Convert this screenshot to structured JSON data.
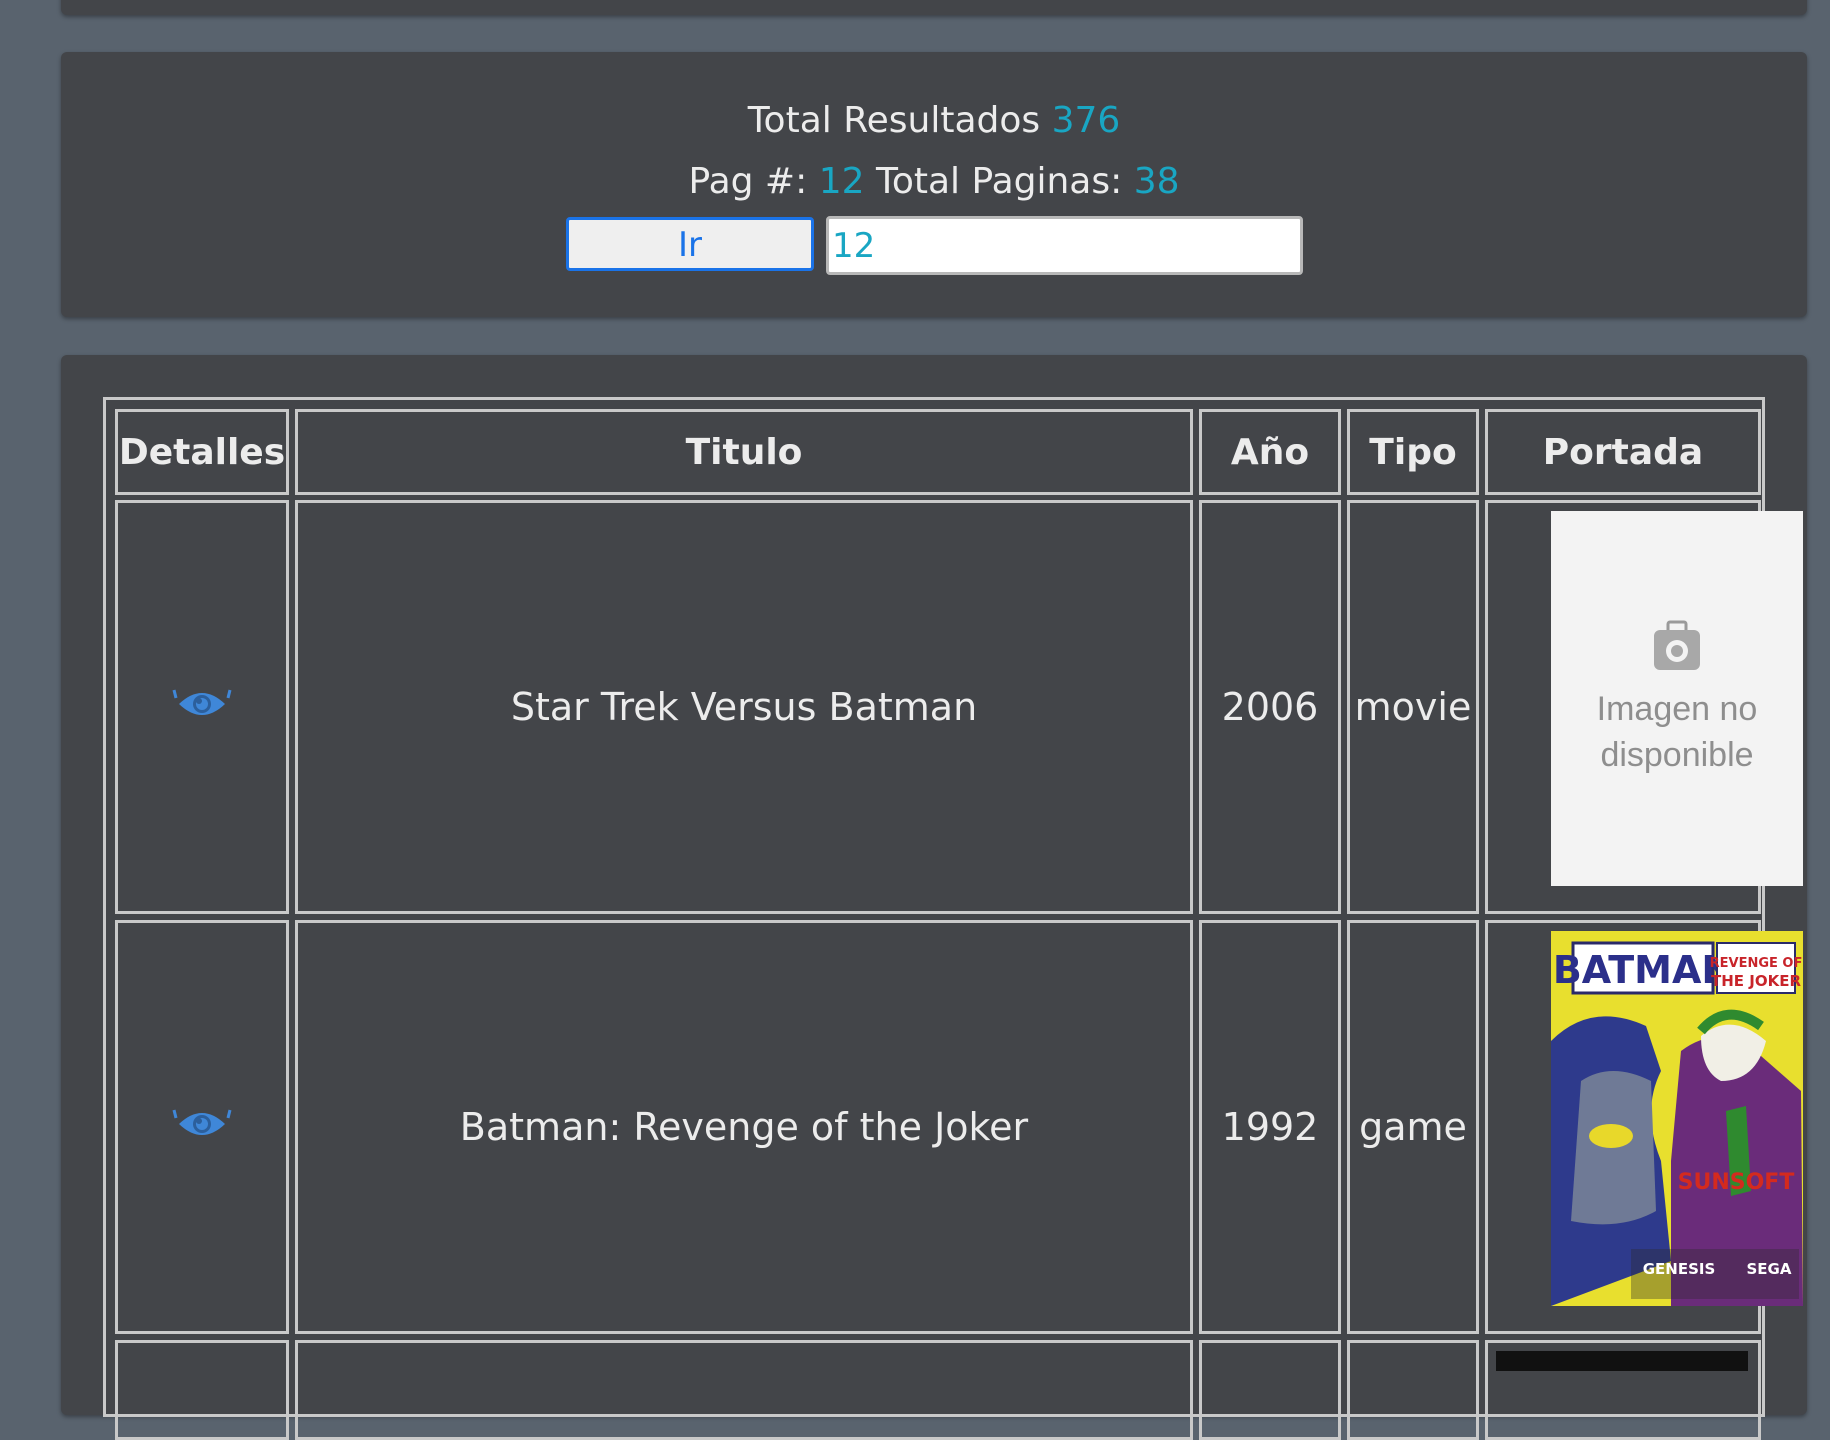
{
  "pager": {
    "total_results_label": "Total Resultados",
    "total_results": "376",
    "page_label": "Pag #:",
    "page": "12",
    "total_pages_label": "Total Paginas:",
    "total_pages": "38",
    "go_button": "Ir",
    "page_input_value": "12"
  },
  "table": {
    "headers": [
      "Detalles",
      "Titulo",
      "Año",
      "Tipo",
      "Portada"
    ],
    "rows": [
      {
        "title": "Star Trek Versus Batman",
        "year": "2006",
        "type": "movie",
        "cover": {
          "available": false,
          "placeholder_text": "Imagen no disponible"
        }
      },
      {
        "title": "Batman: Revenge of the Joker",
        "year": "1992",
        "type": "game",
        "cover": {
          "available": true,
          "logo_text": "BATMAN",
          "subtitle_text": "REVENGE OF THE JOKER",
          "publisher_text": "SUNSOFT",
          "platform_text": "GENESIS",
          "brand_text": "SEGA"
        }
      }
    ]
  },
  "icons": {
    "details": "eye-icon",
    "no_image": "camera-icon"
  },
  "colors": {
    "page_background": "#59636e",
    "panel_background": "#434549",
    "accent_number": "#19a6c3",
    "link_icon": "#3f87d8",
    "button_border": "#1a73e8"
  }
}
